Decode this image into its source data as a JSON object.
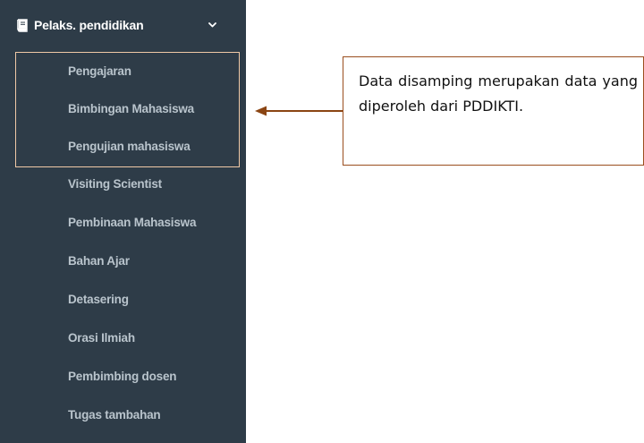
{
  "sidebar": {
    "header": {
      "icon": "book-icon",
      "label": "Pelaks. pendidikan",
      "expand_icon": "chevron-down-icon"
    },
    "items": [
      {
        "label": "Pengajaran"
      },
      {
        "label": "Bimbingan Mahasiswa"
      },
      {
        "label": "Pengujian mahasiswa"
      },
      {
        "label": "Visiting Scientist"
      },
      {
        "label": "Pembinaan Mahasiswa"
      },
      {
        "label": "Bahan Ajar"
      },
      {
        "label": "Detasering"
      },
      {
        "label": "Orasi Ilmiah"
      },
      {
        "label": "Pembimbing dosen"
      },
      {
        "label": "Tugas tambahan"
      }
    ]
  },
  "annotation": {
    "text": "Data disamping merupakan data yang diperoleh dari PDDIKTI."
  },
  "colors": {
    "sidebar_bg": "#2e3c48",
    "item_text": "#b9c4cc",
    "header_text": "#ffffff",
    "highlight_border": "#f0c9a6",
    "callout_border": "#9a4e1e",
    "arrow": "#8b4513"
  }
}
